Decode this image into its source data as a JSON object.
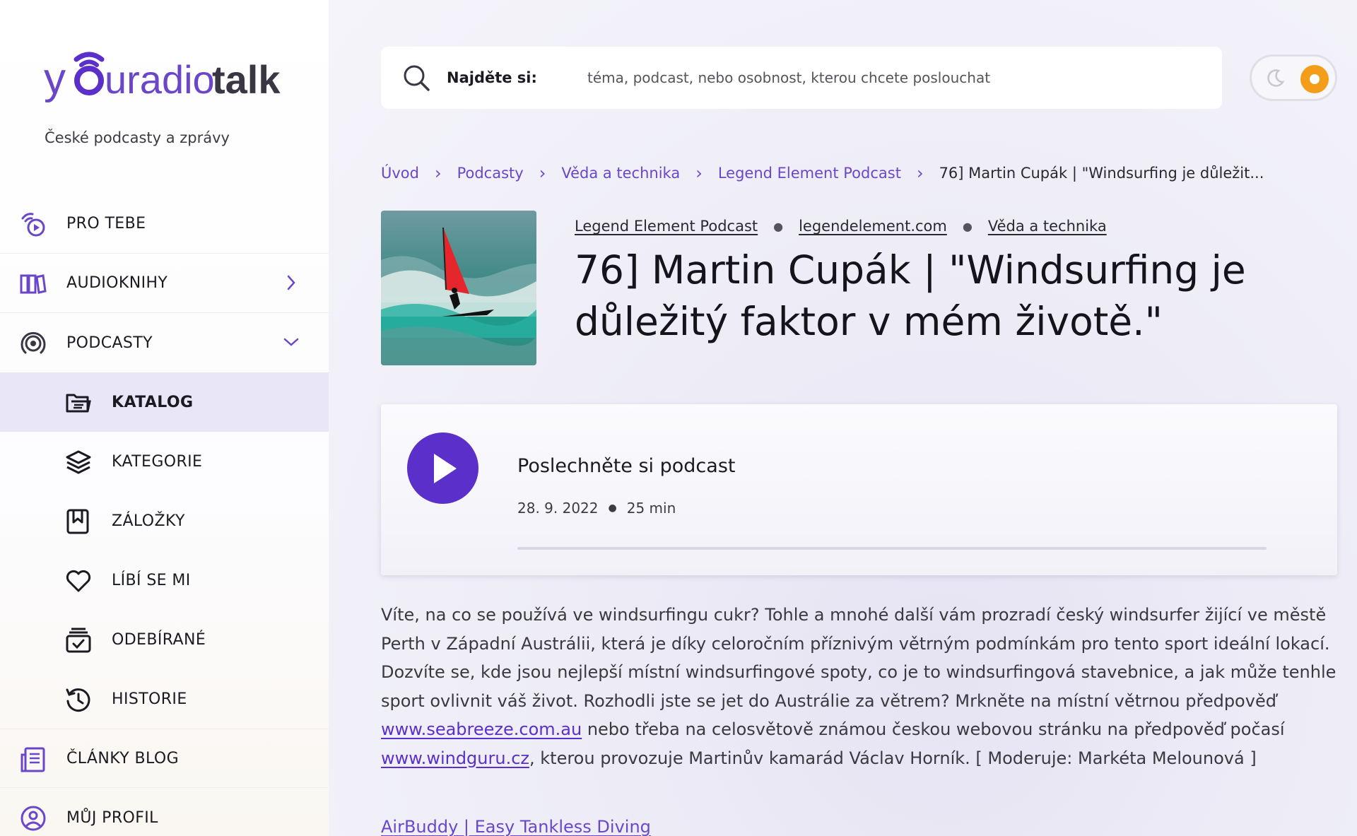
{
  "brand": {
    "logo_word1": "y",
    "logo_word2": "uradio",
    "logo_word3": "talk",
    "tagline": "České podcasty a zprávy",
    "accent_color": "#5b2fc9"
  },
  "sidebar": {
    "items": [
      {
        "label": "PRO TEBE",
        "icon": "broadcast-play-icon"
      },
      {
        "label": "AUDIOKNIHY",
        "icon": "books-icon"
      },
      {
        "label": "PODCASTY",
        "icon": "podcast-icon"
      },
      {
        "label": "KATALOG",
        "icon": "folder-icon"
      },
      {
        "label": "KATEGORIE",
        "icon": "layers-icon"
      },
      {
        "label": "ZÁLOŽKY",
        "icon": "bookmark-icon"
      },
      {
        "label": "LÍBÍ SE MI",
        "icon": "heart-icon"
      },
      {
        "label": "ODEBÍRANÉ",
        "icon": "subscriptions-icon"
      },
      {
        "label": "HISTORIE",
        "icon": "history-icon"
      },
      {
        "label": "ČLÁNKY BLOG",
        "icon": "article-icon"
      },
      {
        "label": "MŮJ PROFIL",
        "icon": "user-icon"
      }
    ]
  },
  "search": {
    "label": "Najděte si:",
    "placeholder": "téma, podcast, nebo osobnost, kterou chcete poslouchat"
  },
  "breadcrumb": {
    "items": [
      "Úvod",
      "Podcasty",
      "Věda a technika",
      "Legend Element Podcast"
    ],
    "current": "76] Martin Cupák | \"Windsurfing je důležit..."
  },
  "episode": {
    "podcast": "Legend Element Podcast",
    "website": "legendelement.com",
    "category": "Věda a technika",
    "title": "76] Martin Cupák | \"Windsurfing je důležitý faktor v mém životě.\""
  },
  "player": {
    "title": "Poslechněte si podcast",
    "date": "28. 9. 2022",
    "duration": "25 min",
    "progress": 0
  },
  "description": {
    "text1": "Víte, na co se používá ve windsurfingu cukr? Tohle a mnohé další vám prozradí český windsurfer žijící ve městě Perth v Západní Austrálii, která je díky celoročním příznivým větrným podmínkám pro tento sport ideální lokací. Dozvíte se, kde jsou nejlepší místní windsurfingové spoty, co je to windsurfingová stavebnice, a jak může tenhle sport ovlivnit váš život. Rozhodli jste se jet do Austrálie za větrem? Mrkněte na místní větrnou předpověď ",
    "link1": "www.seabreeze.com.au",
    "text2": " nebo třeba na celosvětově známou českou webovou stránku na předpověď počasí ",
    "link2": "www.windguru.cz",
    "text3": ", kterou provozuje Martinův kamarád Václav Horník. [ Moderuje: Markéta Melounová ]"
  },
  "related": {
    "link": "AirBuddy | Easy Tankless Diving"
  }
}
